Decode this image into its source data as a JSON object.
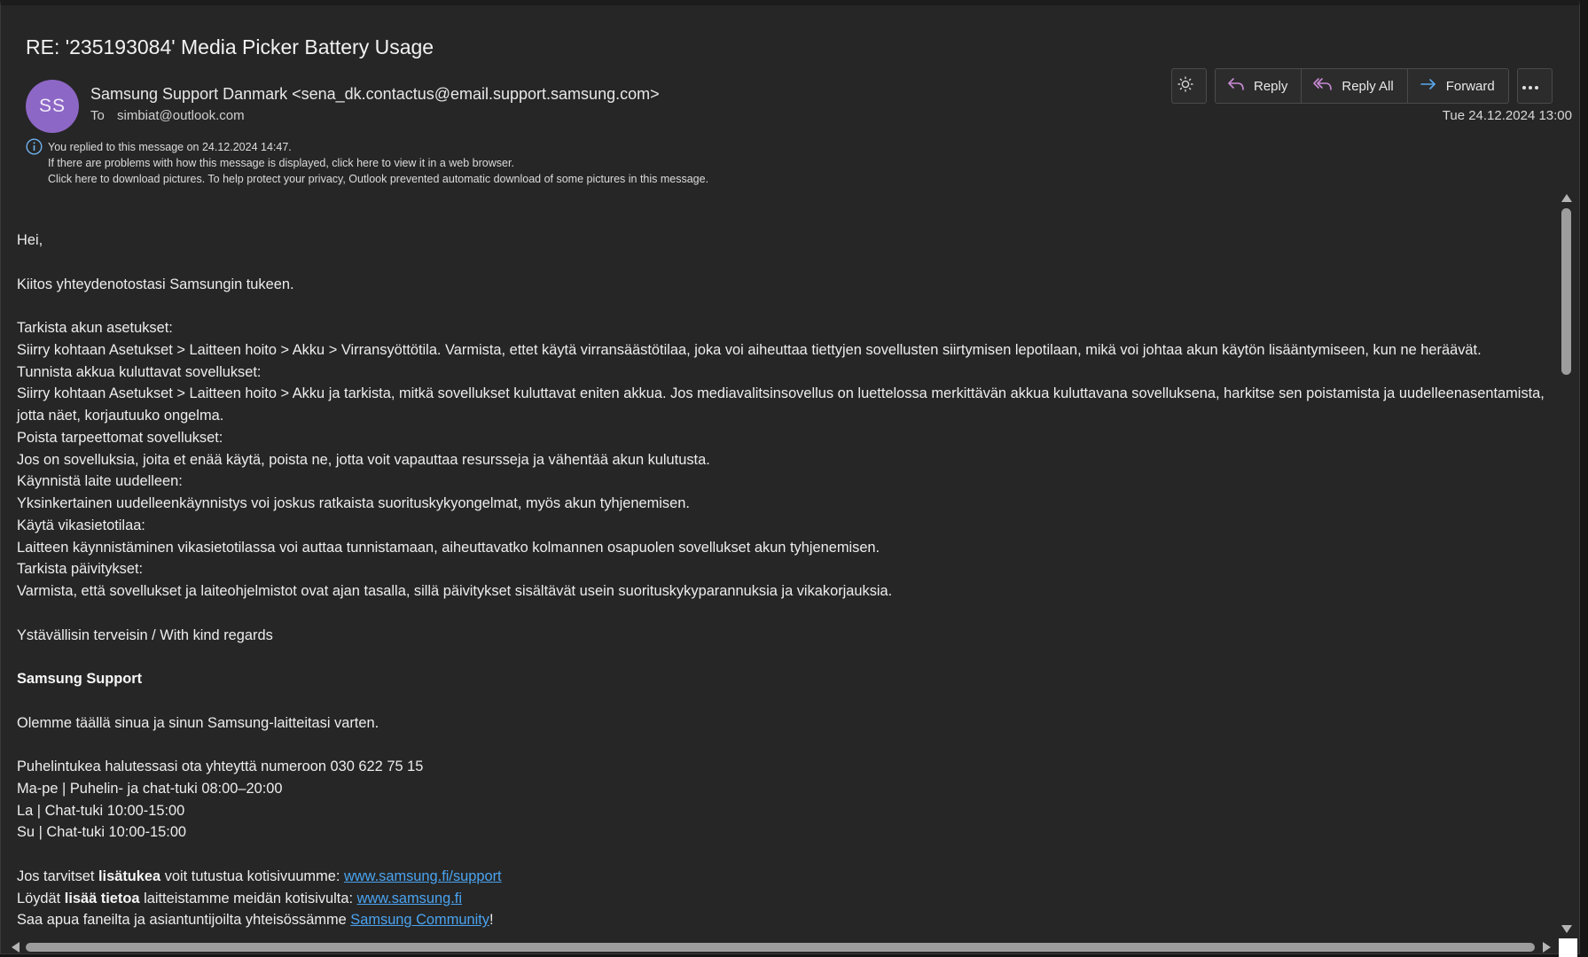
{
  "email": {
    "subject": "RE: '235193084' Media Picker Battery Usage",
    "avatar_initials": "SS",
    "avatar_color": "#8d67c6",
    "sender": "Samsung Support Danmark <sena_dk.contactus@email.support.samsung.com>",
    "to_label": "To",
    "to": "simbiat@outlook.com",
    "date": "Tue 24.12.2024 13:00"
  },
  "toolbar": {
    "theme_icon": "sun-icon",
    "reply_label": "Reply",
    "reply_all_label": "Reply All",
    "forward_label": "Forward",
    "more_icon": "more-horizontal-icon"
  },
  "info": {
    "icon": "info-icon",
    "replied": "You replied to this message on 24.12.2024 14:47.",
    "browser": "If there are problems with how this message is displayed, click here to view it in a web browser.",
    "pictures": "Click here to download pictures. To help protect your privacy, Outlook prevented automatic download of some pictures in this message."
  },
  "body": {
    "greeting": "Hei,",
    "thanks": "Kiitos yhteydenotostasi Samsungin tukeen.",
    "steps": [
      {
        "heading": "Tarkista akun asetukset:",
        "text": "Siirry kohtaan Asetukset > Laitteen hoito > Akku > Virransyöttötila. Varmista, ettet käytä virransäästötilaa, joka voi aiheuttaa tiettyjen sovellusten siirtymisen lepotilaan, mikä voi johtaa akun käytön lisääntymiseen, kun ne heräävät."
      },
      {
        "heading": "Tunnista akkua kuluttavat sovellukset:",
        "text": "Siirry kohtaan Asetukset > Laitteen hoito > Akku ja tarkista, mitkä sovellukset kuluttavat eniten akkua. Jos mediavalitsinsovellus on luettelossa merkittävän akkua kuluttavana sovelluksena, harkitse sen poistamista ja uudelleenasentamista, jotta näet, korjautuuko ongelma."
      },
      {
        "heading": "Poista tarpeettomat sovellukset:",
        "text": "Jos on sovelluksia, joita et enää käytä, poista ne, jotta voit vapauttaa resursseja ja vähentää akun kulutusta."
      },
      {
        "heading": "Käynnistä laite uudelleen:",
        "text": "Yksinkertainen uudelleenkäynnistys voi joskus ratkaista suorituskykyongelmat, myös akun tyhjenemisen."
      },
      {
        "heading": "Käytä vikasietotilaa:",
        "text": "Laitteen käynnistäminen vikasietotilassa voi auttaa tunnistamaan, aiheuttavatko kolmannen osapuolen sovellukset akun tyhjenemisen."
      },
      {
        "heading": "Tarkista päivitykset:",
        "text": "Varmista, että sovellukset ja laiteohjelmistot ovat ajan tasalla, sillä päivitykset sisältävät usein suorituskykyparannuksia ja vikakorjauksia."
      }
    ],
    "regards": "Ystävällisin terveisin / With kind regards",
    "signature": "Samsung Support",
    "tagline": "Olemme täällä sinua ja sinun Samsung-laitteitasi varten.",
    "phone": "Puhelintukea halutessasi ota yhteyttä numeroon 030 622 75 15",
    "hours": [
      "Ma-pe | Puhelin- ja chat-tuki 08:00–20:00",
      "La | Chat-tuki 10:00-15:00",
      "Su | Chat-tuki 10:00-15:00"
    ],
    "links": {
      "support_pre": "Jos tarvitset ",
      "support_bold": "lisätukea",
      "support_mid": " voit tutustua kotisivuumme: ",
      "support_link": "www.samsung.fi/support",
      "info_pre": "Löydät ",
      "info_bold": "lisää tietoa",
      "info_mid": " laitteistamme meidän kotisivulta: ",
      "info_link": "www.samsung.fi ",
      "community_pre": "Saa apua faneilta ja asiantuntijoilta yhteisössämme ",
      "community_link": "Samsung Community",
      "community_post": "!"
    },
    "link_color": "#4aa3f0"
  }
}
